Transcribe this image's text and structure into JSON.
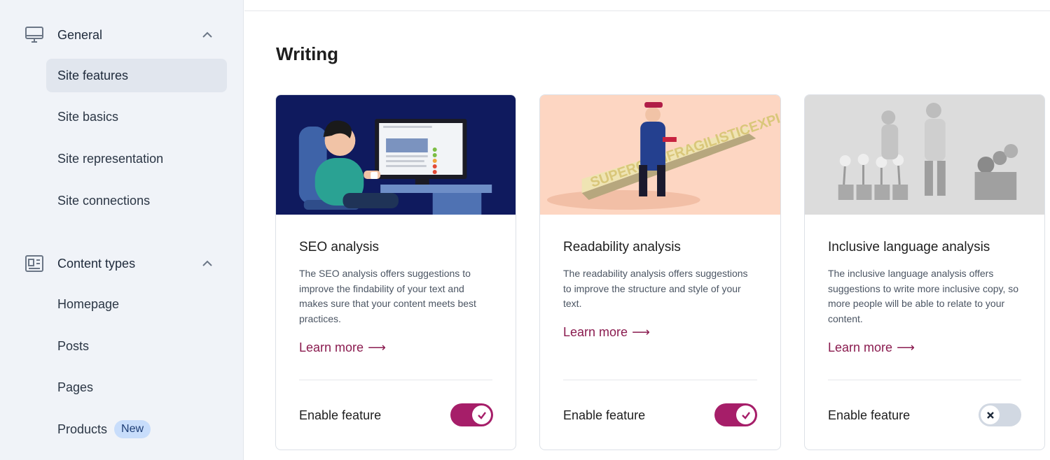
{
  "sidebar": {
    "groups": [
      {
        "label": "General",
        "icon": "desktop-icon",
        "items": [
          {
            "label": "Site features",
            "active": true
          },
          {
            "label": "Site basics"
          },
          {
            "label": "Site representation"
          },
          {
            "label": "Site connections"
          }
        ]
      },
      {
        "label": "Content types",
        "icon": "content-types-icon",
        "items": [
          {
            "label": "Homepage"
          },
          {
            "label": "Posts"
          },
          {
            "label": "Pages"
          },
          {
            "label": "Products",
            "badge": "New"
          }
        ]
      }
    ]
  },
  "main": {
    "section_title": "Writing",
    "cards": [
      {
        "title": "SEO analysis",
        "description": "The SEO analysis offers suggestions to improve the findability of your text and makes sure that your content meets best practices.",
        "learn_more": "Learn more",
        "arrow": "⟶",
        "enable_label": "Enable feature",
        "enabled": true
      },
      {
        "title": "Readability analysis",
        "description": "The readability analysis offers suggestions to improve the structure and style of your text.",
        "learn_more": "Learn more",
        "arrow": "⟶",
        "enable_label": "Enable feature",
        "enabled": true
      },
      {
        "title": "Inclusive language analysis",
        "description": "The inclusive language analysis offers suggestions to write more inclusive copy, so more people will be able to relate to your content.",
        "learn_more": "Learn more",
        "arrow": "⟶",
        "enable_label": "Enable feature",
        "enabled": false
      }
    ],
    "illustration_text": "SUPERCALIFRAGILISTICEXPIALIDOCIOUS"
  },
  "colors": {
    "accent": "#a61e69",
    "link": "#8a1b4f",
    "sidebar_bg": "#f0f3f8",
    "seo_banner": "#0f1a5e",
    "readability_banner": "#fdd6c2",
    "inclusive_banner": "#dcdcdc"
  }
}
